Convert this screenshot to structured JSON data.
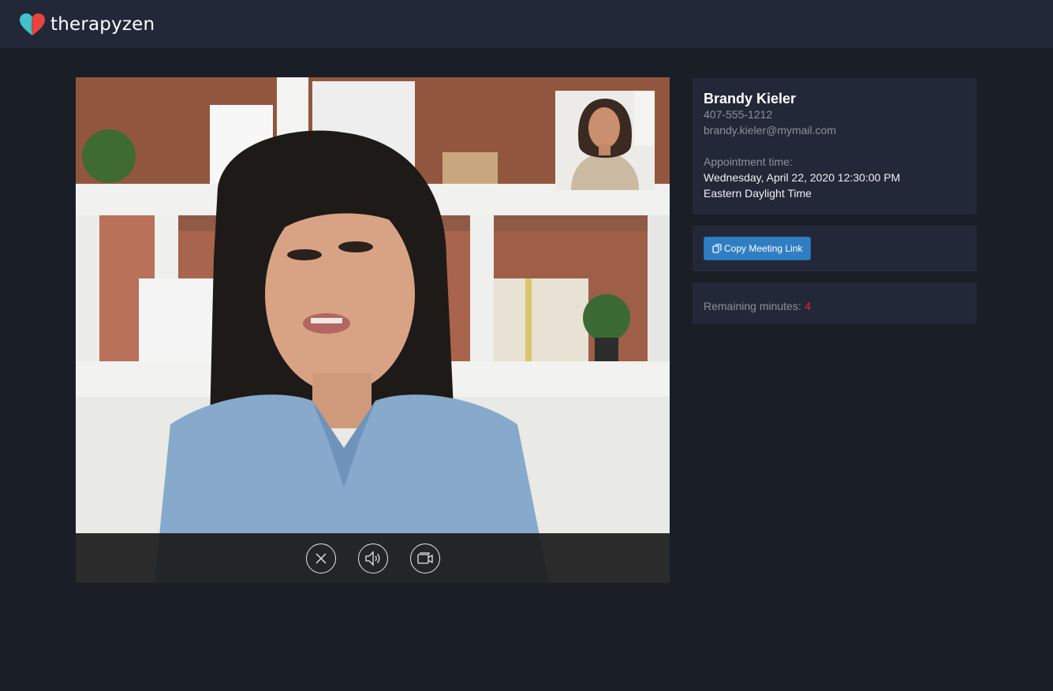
{
  "app": {
    "brand": "therapyzen",
    "brand_colors": {
      "heart_left": "#3fc2c9",
      "heart_right": "#e8433e"
    }
  },
  "video": {
    "controls": [
      {
        "icon": "close-icon"
      },
      {
        "icon": "speaker-icon"
      },
      {
        "icon": "camera-icon"
      }
    ]
  },
  "client": {
    "name": "Brandy Kieler",
    "phone": "407-555-1212",
    "email": "brandy.kieler@mymail.com",
    "appointment_label": "Appointment time:",
    "appointment_datetime": "Wednesday, April 22, 2020 12:30:00 PM",
    "timezone": "Eastern Daylight Time"
  },
  "actions": {
    "copy_link_label": "Copy Meeting Link",
    "copy_link_icon": "copy-icon"
  },
  "session": {
    "remaining_label": "Remaining minutes:",
    "remaining_value": "4"
  },
  "colors": {
    "page_bg": "#1a1e27",
    "panel_bg": "#222837",
    "accent_button": "#2f7ec4",
    "alert": "#e8262b"
  }
}
